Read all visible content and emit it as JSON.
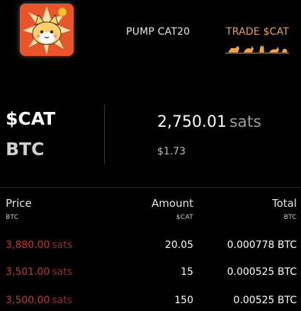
{
  "nav": {
    "pump_label": "PUMP CAT20",
    "trade_label": "TRADE $CAT"
  },
  "token": {
    "symbol": "$CAT",
    "quote": "BTC",
    "price": "2,750.01",
    "price_unit": "sats",
    "usd_price": "$1.73"
  },
  "orderbook": {
    "headers": {
      "price": "Price",
      "price_sub": "BTC",
      "amount": "Amount",
      "amount_sub": "$CAT",
      "total": "Total",
      "total_sub": "BTC"
    },
    "rows": [
      {
        "price": "3,880.00",
        "unit": "sats",
        "amount": "20.05",
        "total": "0.000778 BTC"
      },
      {
        "price": "3,501.00",
        "unit": "sats",
        "amount": "15",
        "total": "0.000525 BTC"
      },
      {
        "price": "3,500.00",
        "unit": "sats",
        "amount": "150",
        "total": "0.00525 BTC"
      }
    ]
  },
  "colors": {
    "accent": "#f2a24a",
    "sell": "#c0392b",
    "background": "#000000"
  }
}
